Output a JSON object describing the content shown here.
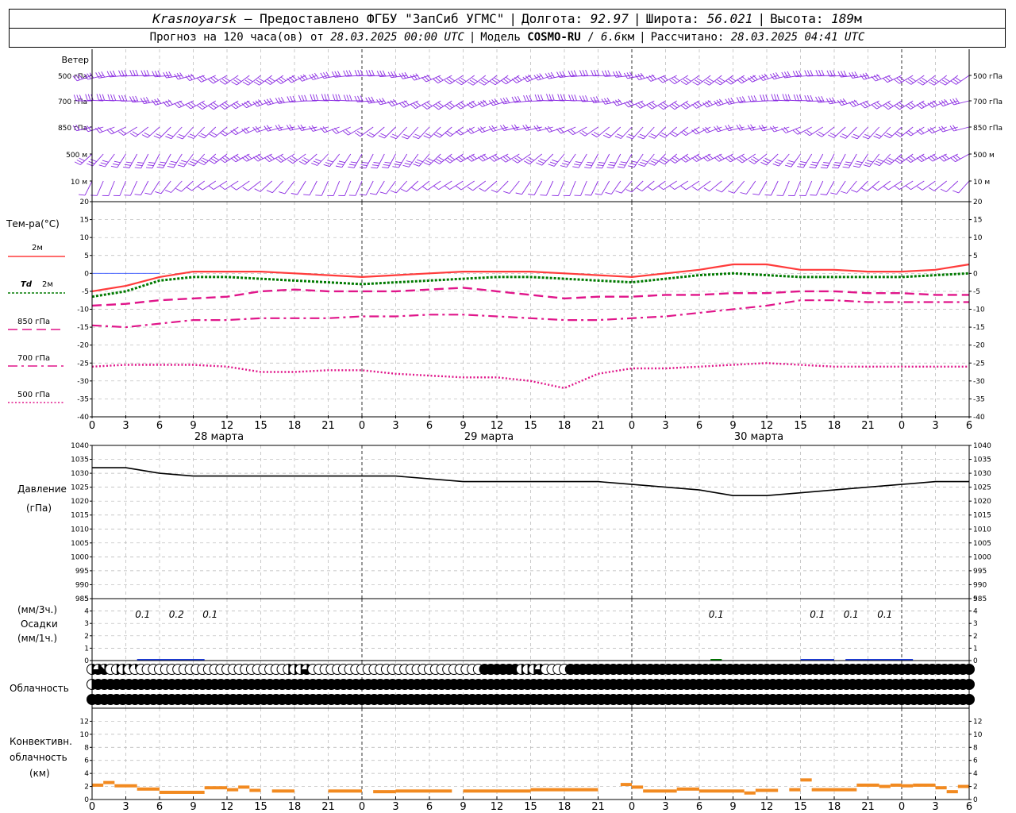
{
  "header": {
    "city": "Krasnoyarsk",
    "provider": "– Предоставлено ФГБУ \"ЗапСиб УГМС\"",
    "lon_label": "Долгота:",
    "lon_value": "92.97",
    "lat_label": "Широта:",
    "lat_value": "56.021",
    "alt_label": "Высота:",
    "alt_value": "189",
    "alt_unit": "м",
    "forecast_label": "Прогноз на 120 часа(ов) от",
    "forecast_start": "28.03.2025 00:00 UTC",
    "model_label": "Модель",
    "model_name": "COSMO-RU",
    "model_res": "6.6",
    "model_res_unit": "км",
    "calc_label": "Рассчитано:",
    "calc_time": "28.03.2025 04:41 UTC"
  },
  "colors": {
    "wind": "#8a2be2",
    "t2m": "#ff3b3b",
    "td2m": "#007a00",
    "t850": "#e0158a",
    "t700": "#e0158a",
    "t500": "#e0158a",
    "pressure": "#000000",
    "precip": "#1f3fe0",
    "conv": "#f28a20",
    "grid": "#b4b4b4"
  },
  "chart_data": [
    {
      "type": "barbs",
      "panel": "wind",
      "title": "Ветер",
      "levels": [
        "500 гПа",
        "700 гПа",
        "850 гПа",
        "500 м",
        "10 м"
      ]
    },
    {
      "type": "line",
      "panel": "temperature",
      "ylabel": "Тем-ра(°С)",
      "ylim": [
        -40,
        20
      ],
      "yticks": [
        "20",
        "15",
        "10",
        "5",
        "0",
        "-5",
        "-10",
        "-15",
        "-20",
        "-25",
        "-30",
        "-35",
        "-40"
      ],
      "x_hours": [
        0,
        3,
        6,
        9,
        12,
        15,
        18,
        21,
        24,
        27,
        30,
        33,
        36,
        39,
        42,
        45,
        48,
        51,
        54,
        57,
        60,
        63,
        66,
        69,
        72,
        75,
        78
      ],
      "series": [
        {
          "name": "2м",
          "style": "solid",
          "values": [
            -5,
            -3.5,
            -1,
            0.5,
            0.5,
            0.5,
            0,
            -0.5,
            -1,
            -0.5,
            0,
            0.5,
            0.5,
            0.5,
            0,
            -0.5,
            -1,
            0,
            1,
            2.5,
            2.5,
            1,
            1,
            0.5,
            0.5,
            1,
            2.5
          ]
        },
        {
          "name": "Td 2м",
          "style": "dotted",
          "values": [
            -6.5,
            -5,
            -2,
            -1,
            -1,
            -1.5,
            -2,
            -2.5,
            -3,
            -2.5,
            -2,
            -1.5,
            -1,
            -1,
            -1.5,
            -2,
            -2.5,
            -1.5,
            -0.5,
            0,
            -0.5,
            -1,
            -1,
            -1,
            -1,
            -0.5,
            0
          ]
        },
        {
          "name": "850 гПа",
          "style": "dashed",
          "values": [
            -9,
            -8.5,
            -7.5,
            -7,
            -6.5,
            -5,
            -4.5,
            -5,
            -5,
            -5,
            -4.5,
            -4,
            -5,
            -6,
            -7,
            -6.5,
            -6.5,
            -6,
            -6,
            -5.5,
            -5.5,
            -5,
            -5,
            -5.5,
            -5.5,
            -6,
            -6
          ]
        },
        {
          "name": "700 гПа",
          "style": "dashdot",
          "values": [
            -14.5,
            -15,
            -14,
            -13,
            -13,
            -12.5,
            -12.5,
            -12.5,
            -12,
            -12,
            -11.5,
            -11.5,
            -12,
            -12.5,
            -13,
            -13,
            -12.5,
            -12,
            -11,
            -10,
            -9,
            -7.5,
            -7.5,
            -8,
            -8,
            -8,
            -8
          ]
        },
        {
          "name": "500 гПа",
          "style": "densedot",
          "values": [
            -26,
            -25.5,
            -25.5,
            -25.5,
            -26,
            -27.5,
            -27.5,
            -27,
            -27,
            -28,
            -28.5,
            -29,
            -29,
            -30,
            -32,
            -28,
            -26.5,
            -26.5,
            -26,
            -25.5,
            -25,
            -25.5,
            -26,
            -26,
            -26,
            -26,
            -26
          ]
        }
      ]
    },
    {
      "type": "line",
      "panel": "pressure",
      "ylabel": "Давление",
      "yunit": "(гПа)",
      "ylim": [
        985,
        1040
      ],
      "yticks": [
        "1040",
        "1035",
        "1030",
        "1025",
        "1020",
        "1015",
        "1010",
        "1005",
        "1000",
        "995",
        "990",
        "985"
      ],
      "x_hours": [
        0,
        3,
        6,
        9,
        12,
        15,
        18,
        21,
        24,
        27,
        30,
        33,
        36,
        39,
        42,
        45,
        48,
        51,
        54,
        57,
        60,
        63,
        66,
        69,
        72,
        75,
        78
      ],
      "values": [
        1032,
        1032,
        1030,
        1029,
        1029,
        1029,
        1029,
        1029,
        1029,
        1029,
        1028,
        1027,
        1027,
        1027,
        1027,
        1027,
        1026,
        1025,
        1024,
        1022,
        1022,
        1023,
        1024,
        1025,
        1026,
        1027,
        1027
      ]
    },
    {
      "type": "bar",
      "panel": "precip",
      "ylabel_3h": "(мм/3ч.)",
      "ylabel": "Осадки",
      "ylabel_1h": "(мм/1ч.)",
      "ylim": [
        0,
        5
      ],
      "yticks": [
        "5",
        "4",
        "3",
        "2",
        "1",
        "0"
      ],
      "labels": [
        {
          "hour": 4.5,
          "text": "0.1"
        },
        {
          "hour": 7.5,
          "text": "0.2"
        },
        {
          "hour": 10.5,
          "text": "0.1"
        },
        {
          "hour": 55.5,
          "text": "0.1"
        },
        {
          "hour": 64.5,
          "text": "0.1"
        },
        {
          "hour": 67.5,
          "text": "0.1"
        },
        {
          "hour": 70.5,
          "text": "0.1"
        }
      ],
      "bars": [
        {
          "from": 4,
          "to": 10,
          "value": 0.1,
          "color": "precip"
        },
        {
          "from": 55,
          "to": 56,
          "value": 0.05,
          "color": "td2m"
        },
        {
          "from": 63,
          "to": 66,
          "value": 0.08,
          "color": "precip"
        },
        {
          "from": 67,
          "to": 73,
          "value": 0.1,
          "color": "precip"
        }
      ]
    },
    {
      "type": "table",
      "panel": "cloud",
      "ylabel": "Облачность",
      "rows": 3,
      "interval_hours": 1,
      "cover_octas": [
        [
          4,
          6,
          7,
          0,
          4,
          4,
          2,
          2,
          0,
          0,
          0,
          0,
          0,
          0,
          0,
          0,
          0,
          0,
          0,
          0,
          0,
          0,
          0,
          0,
          0,
          0,
          0,
          0,
          0,
          0,
          0,
          0,
          4,
          4,
          4,
          6,
          0,
          0,
          0,
          0,
          0,
          0,
          0,
          0,
          0,
          0,
          0,
          0,
          0,
          0,
          0,
          0,
          0,
          0,
          0,
          0,
          0,
          0,
          0,
          0,
          0,
          0,
          0,
          0,
          8,
          8,
          8,
          8,
          8,
          8,
          4,
          4,
          4,
          6,
          0,
          0,
          0,
          0,
          8,
          8,
          8,
          8,
          8,
          8,
          8,
          8,
          8,
          8,
          8,
          8,
          8,
          8,
          8,
          8,
          8,
          8,
          8,
          8,
          8,
          8,
          8,
          8,
          8,
          8,
          8,
          8,
          8,
          8,
          8,
          8,
          8,
          8,
          8,
          8,
          8,
          8,
          8,
          8,
          8,
          8,
          8,
          8,
          8,
          8,
          8,
          8,
          8,
          8,
          8,
          8,
          8,
          8,
          8,
          8,
          8,
          8,
          8,
          8,
          8,
          8,
          8,
          8,
          8,
          8
        ],
        [
          4,
          8,
          8,
          8,
          8,
          8,
          8,
          8,
          8,
          8,
          8,
          8,
          8,
          8,
          8,
          8,
          8,
          8,
          8,
          8,
          8,
          8,
          8,
          8,
          8,
          8,
          8,
          8,
          8,
          8,
          8,
          8,
          8,
          8,
          8,
          8,
          8,
          8,
          8,
          8,
          8,
          8,
          8,
          8,
          8,
          8,
          8,
          8,
          8,
          8,
          8,
          8,
          8,
          8,
          8,
          8,
          8,
          8,
          8,
          8,
          8,
          8,
          8,
          8,
          8,
          8,
          8,
          8,
          8,
          8,
          8,
          8,
          8,
          8,
          8,
          8,
          8,
          8,
          8,
          8,
          8,
          8,
          8,
          8,
          8,
          8,
          8,
          8,
          8,
          8,
          8,
          8,
          8,
          8,
          8,
          8,
          8,
          8,
          8,
          8,
          8,
          8,
          8,
          8,
          8,
          8,
          8,
          8,
          8,
          8,
          8,
          8,
          8,
          8,
          8,
          8,
          8,
          8,
          8,
          8,
          8,
          8,
          8,
          8,
          8,
          8,
          8,
          8,
          8,
          8,
          8,
          8,
          8,
          8,
          8,
          8,
          8,
          8,
          8,
          8,
          8,
          8,
          8,
          8
        ],
        [
          8,
          8,
          8,
          8,
          8,
          8,
          8,
          8,
          8,
          8,
          8,
          8,
          8,
          8,
          8,
          8,
          8,
          8,
          8,
          8,
          8,
          8,
          8,
          8,
          8,
          8,
          8,
          8,
          8,
          8,
          8,
          8,
          8,
          8,
          8,
          8,
          8,
          8,
          8,
          8,
          8,
          8,
          8,
          8,
          8,
          8,
          8,
          8,
          8,
          8,
          8,
          8,
          8,
          8,
          8,
          8,
          8,
          8,
          8,
          8,
          8,
          8,
          8,
          8,
          8,
          8,
          8,
          8,
          8,
          8,
          8,
          8,
          8,
          8,
          8,
          8,
          8,
          8,
          8,
          8,
          8,
          8,
          8,
          8,
          8,
          8,
          8,
          8,
          8,
          8,
          8,
          8,
          8,
          8,
          8,
          8,
          8,
          8,
          8,
          8,
          8,
          8,
          8,
          8,
          8,
          8,
          8,
          8,
          8,
          8,
          8,
          8,
          8,
          8,
          8,
          8,
          8,
          8,
          8,
          8,
          8,
          8,
          8,
          8,
          8,
          8,
          8,
          8,
          8,
          8,
          8,
          8,
          8,
          8,
          8,
          8,
          8,
          8,
          8,
          8,
          8,
          8,
          8,
          8
        ]
      ]
    },
    {
      "type": "bar",
      "panel": "convective",
      "ylabel_lines": [
        "Конвективн.",
        "облачность",
        "(км)"
      ],
      "ylim": [
        0,
        14
      ],
      "yticks": [
        "12",
        "10",
        "8",
        "6",
        "4",
        "2",
        "0"
      ],
      "segments": [
        {
          "from": 0,
          "to": 1,
          "value": 2.2
        },
        {
          "from": 1,
          "to": 2,
          "value": 2.6
        },
        {
          "from": 2,
          "to": 4,
          "value": 2.1
        },
        {
          "from": 4,
          "to": 6,
          "value": 1.6
        },
        {
          "from": 6,
          "to": 10,
          "value": 1.1
        },
        {
          "from": 10,
          "to": 12,
          "value": 1.8
        },
        {
          "from": 12,
          "to": 13,
          "value": 1.5
        },
        {
          "from": 13,
          "to": 14,
          "value": 1.9
        },
        {
          "from": 14,
          "to": 15,
          "value": 1.4
        },
        {
          "from": 16,
          "to": 18,
          "value": 1.3
        },
        {
          "from": 21,
          "to": 24,
          "value": 1.3
        },
        {
          "from": 25,
          "to": 27,
          "value": 1.2
        },
        {
          "from": 27,
          "to": 32,
          "value": 1.3
        },
        {
          "from": 33,
          "to": 39,
          "value": 1.3
        },
        {
          "from": 39,
          "to": 45,
          "value": 1.5
        },
        {
          "from": 47,
          "to": 48,
          "value": 2.3
        },
        {
          "from": 48,
          "to": 49,
          "value": 1.9
        },
        {
          "from": 49,
          "to": 52,
          "value": 1.3
        },
        {
          "from": 52,
          "to": 54,
          "value": 1.6
        },
        {
          "from": 54,
          "to": 58,
          "value": 1.3
        },
        {
          "from": 58,
          "to": 59,
          "value": 1.0
        },
        {
          "from": 59,
          "to": 61,
          "value": 1.4
        },
        {
          "from": 62,
          "to": 63,
          "value": 1.5
        },
        {
          "from": 63,
          "to": 64,
          "value": 3.0
        },
        {
          "from": 64,
          "to": 66,
          "value": 1.5
        },
        {
          "from": 66,
          "to": 68,
          "value": 1.5
        },
        {
          "from": 68,
          "to": 70,
          "value": 2.2
        },
        {
          "from": 70,
          "to": 71,
          "value": 2.0
        },
        {
          "from": 71,
          "to": 72,
          "value": 2.2
        },
        {
          "from": 72,
          "to": 73,
          "value": 2.1
        },
        {
          "from": 73,
          "to": 75,
          "value": 2.2
        },
        {
          "from": 75,
          "to": 76,
          "value": 1.8
        },
        {
          "from": 76,
          "to": 77,
          "value": 1.2
        },
        {
          "from": 77,
          "to": 78,
          "value": 2.0
        }
      ]
    }
  ],
  "x_axis": {
    "tick_labels": [
      "0",
      "3",
      "6",
      "9",
      "12",
      "15",
      "18",
      "21",
      "0",
      "3",
      "6",
      "9",
      "12",
      "15",
      "18",
      "21",
      "0",
      "3",
      "6",
      "9",
      "12",
      "15",
      "18",
      "21",
      "0",
      "3",
      "6"
    ],
    "days": [
      {
        "hour": 12,
        "label": "28 марта"
      },
      {
        "hour": 36,
        "label": "29 марта"
      },
      {
        "hour": 60,
        "label": "30 марта"
      }
    ]
  },
  "legend": {
    "t2m_label": "2м",
    "td_label": "Td",
    "td_suffix": "2м",
    "t850_label": "850 гПа",
    "t700_label": "700 гПа",
    "t500_label": "500 гПа"
  }
}
